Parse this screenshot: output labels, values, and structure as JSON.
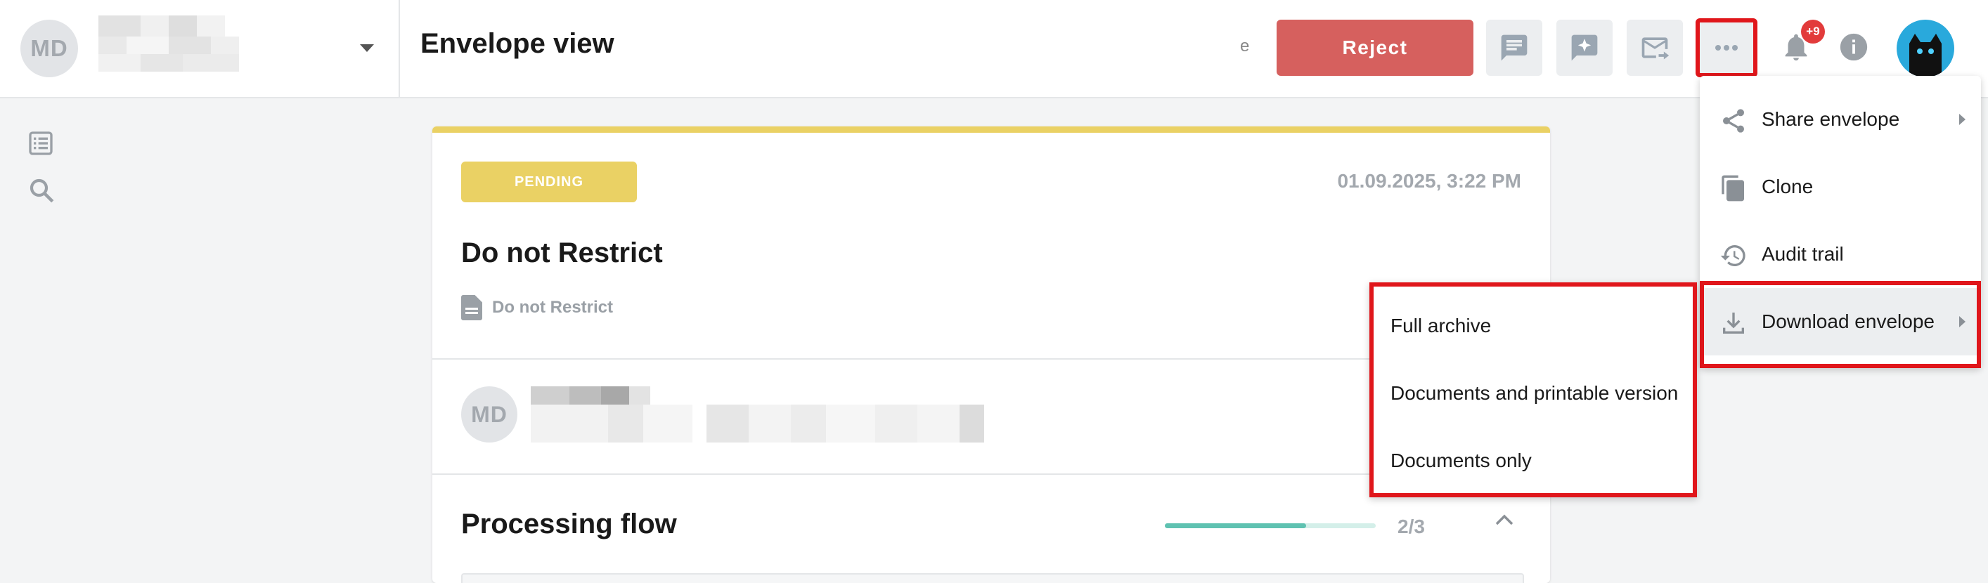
{
  "header": {
    "user_initials": "MD",
    "page_title": "Envelope view",
    "reject_label": "Reject",
    "notification_badge": "+9",
    "partial_text": "e"
  },
  "card": {
    "status": "PENDING",
    "date": "01.09.2025, 3:22 PM",
    "title": "Do not Restrict",
    "document_name": "Do not Restrict",
    "signer_initials": "MD",
    "flow_title": "Processing flow",
    "flow_progress_text": "2/3",
    "flow_progress_fraction": 0.67
  },
  "more_menu": {
    "items": [
      {
        "label": "Share envelope",
        "icon": "share-icon"
      },
      {
        "label": "Clone",
        "icon": "copy-icon"
      },
      {
        "label": "Audit trail",
        "icon": "history-icon"
      },
      {
        "label": "Download envelope",
        "icon": "download-icon"
      }
    ]
  },
  "download_submenu": {
    "items": [
      "Full archive",
      "Documents and printable version",
      "Documents only"
    ]
  },
  "colors": {
    "accent_yellow": "#ead164",
    "reject_red": "#d6605e",
    "highlight_red": "#e0161b",
    "progress_teal": "#5fc2b1"
  }
}
